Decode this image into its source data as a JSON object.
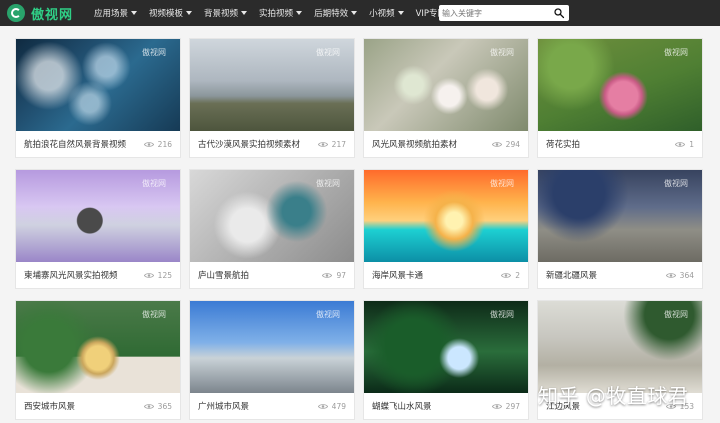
{
  "brand": {
    "name": "傲视网"
  },
  "nav": [
    {
      "label": "应用场景",
      "has_caret": true
    },
    {
      "label": "视频模板",
      "has_caret": true
    },
    {
      "label": "背景视频",
      "has_caret": true
    },
    {
      "label": "实拍视频",
      "has_caret": true
    },
    {
      "label": "后期特效",
      "has_caret": true
    },
    {
      "label": "小视频",
      "has_caret": true
    },
    {
      "label": "VIP专区",
      "has_caret": false
    }
  ],
  "search": {
    "placeholder": "输入关键字",
    "icon": "search-icon"
  },
  "watermark": "傲视网",
  "cards": [
    {
      "title": "航拍浪花自然风景背景视频",
      "views": "216"
    },
    {
      "title": "古代沙漠风景实拍视频素材",
      "views": "217"
    },
    {
      "title": "风光风景视频航拍素材",
      "views": "294"
    },
    {
      "title": "荷花实拍",
      "views": "1"
    },
    {
      "title": "柬埔寨风光风景实拍视频",
      "views": "125"
    },
    {
      "title": "庐山雪景航拍",
      "views": "97"
    },
    {
      "title": "海岸风景卡通",
      "views": "2"
    },
    {
      "title": "新疆北疆风景",
      "views": "364"
    },
    {
      "title": "西安城市风景",
      "views": "365"
    },
    {
      "title": "广州城市风景",
      "views": "479"
    },
    {
      "title": "蝴蝶飞山水风景",
      "views": "297"
    },
    {
      "title": "江边风景",
      "views": "153"
    }
  ],
  "overlay_text": "知乎 @牧直球君"
}
